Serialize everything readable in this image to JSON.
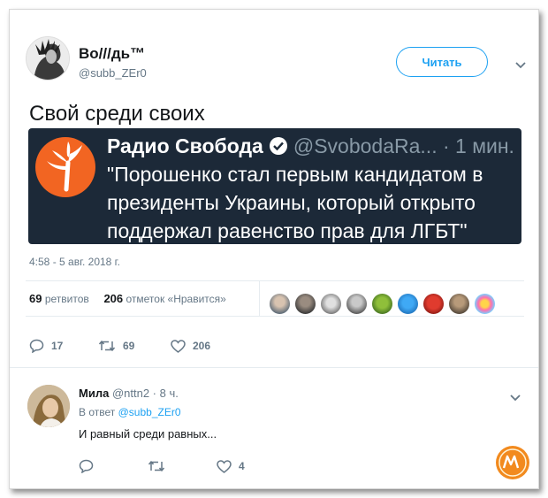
{
  "tweet": {
    "author_name": "Во///дь™",
    "author_handle": "@subb_ZEr0",
    "follow_label": "Читать",
    "text": "Свой среди своих",
    "timestamp": "4:58 - 5 авг. 2018 г.",
    "retweets_count": "69",
    "retweets_label": "ретвитов",
    "likes_count": "206",
    "likes_label": "отметок «Нравится»",
    "reply_count": "17",
    "retweet_count": "69",
    "like_count": "206"
  },
  "embed": {
    "name": "Радио Свобода",
    "handle": "@SvobodaRa... · 1 мин.",
    "quote": "\"Порошенко стал первым кандидатом в президенты Украины, который открыто поддержал равенство прав для ЛГБТ\""
  },
  "reply": {
    "name": "Мила",
    "meta": "@nttn2 · 8 ч.",
    "reply_prefix": "В ответ",
    "reply_to": "@subb_ZEr0",
    "text": "И равный среди равных...",
    "like_count": "4"
  },
  "colors": {
    "accent": "#1da1f2",
    "secondary_text": "#657786",
    "embed_bg": "#1c2938",
    "logo_orange": "#f26522"
  }
}
